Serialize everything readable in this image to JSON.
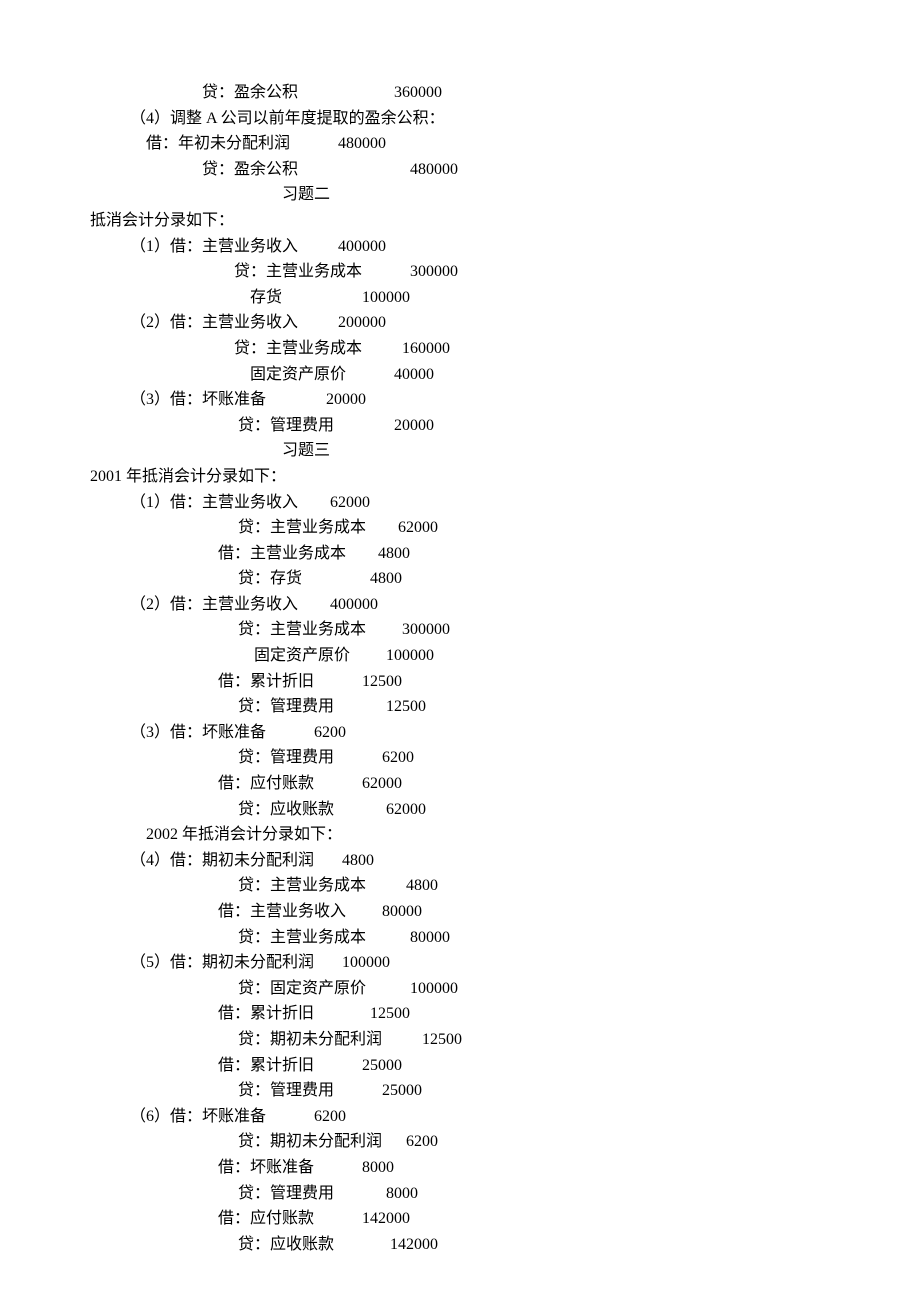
{
  "lines": {
    "l1": "        贷：盈余公积                        360000",
    "l2": "（4）调整 A 公司以前年度提取的盈余公积：",
    "l3": "    借：年初未分配利润            480000",
    "l4": "        贷：盈余公积                            480000",
    "title2": "习题二",
    "l5": "抵消会计分录如下：",
    "l6": "（1）借：主营业务收入          400000",
    "l7": "        贷：主营业务成本            300000",
    "l8": "            存货                    100000",
    "l9": "（2）借：主营业务收入          200000",
    "l10": "        贷：主营业务成本          160000",
    "l11": "            固定资产原价            40000",
    "l12": "（3）借：坏账准备               20000",
    "l13": "         贷：管理费用               20000",
    "title3": "习题三",
    "l14": "2001 年抵消会计分录如下：",
    "l15": "（1）借：主营业务收入        62000",
    "l16": "         贷：主营业务成本        62000",
    "l17": "    借：主营业务成本        4800",
    "l18": "         贷：存货                 4800",
    "l19": "（2）借：主营业务收入        400000",
    "l20": "         贷：主营业务成本         300000",
    "l21": "             固定资产原价         100000",
    "l22": "    借：累计折旧            12500",
    "l23": "         贷：管理费用             12500",
    "l24": "（3）借：坏账准备            6200",
    "l25": "         贷：管理费用            6200",
    "l26": "    借：应付账款            62000",
    "l27": "         贷：应收账款             62000",
    "l28": "    2002 年抵消会计分录如下：",
    "l29": "（4）借：期初未分配利润       4800",
    "l30": "         贷：主营业务成本          4800",
    "l31": "    借：主营业务收入         80000",
    "l32": "         贷：主营业务成本           80000",
    "l33": "（5）借：期初未分配利润       100000",
    "l34": "         贷：固定资产原价           100000",
    "l35": "    借：累计折旧              12500",
    "l36": "         贷：期初未分配利润          12500",
    "l37": "    借：累计折旧            25000",
    "l38": "         贷：管理费用            25000",
    "l39": "（6）借：坏账准备            6200",
    "l40": "         贷：期初未分配利润      6200",
    "l41": "    借：坏账准备            8000",
    "l42": "         贷：管理费用             8000",
    "l43": "    借：应付账款            142000",
    "l44": "         贷：应收账款              142000"
  }
}
